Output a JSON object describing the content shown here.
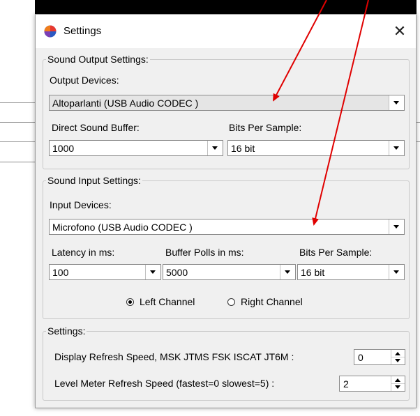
{
  "window": {
    "title": "Settings",
    "close_glyph": "✕",
    "icon": "app-logo-icon"
  },
  "output_group": {
    "legend": "Sound Output Settings:",
    "devices_label": "Output Devices:",
    "device_value": "Altoparlanti (USB Audio CODEC )",
    "buffer_label": "Direct Sound Buffer:",
    "buffer_value": "1000",
    "bits_label": "Bits Per Sample:",
    "bits_value": "16 bit"
  },
  "input_group": {
    "legend": "Sound Input Settings:",
    "devices_label": "Input Devices:",
    "device_value": "Microfono (USB Audio CODEC )",
    "latency_label": "Latency in ms:",
    "latency_value": "100",
    "polls_label": "Buffer Polls in ms:",
    "polls_value": "5000",
    "bits_label": "Bits Per Sample:",
    "bits_value": "16 bit",
    "channels": [
      {
        "label": "Left Channel",
        "selected": true
      },
      {
        "label": "Right Channel",
        "selected": false
      }
    ]
  },
  "settings_group": {
    "legend": "Settings:",
    "display_label": "Display Refresh Speed, MSK JTMS FSK ISCAT JT6M :",
    "display_value": "0",
    "meter_label": "Level Meter Refresh Speed (fastest=0 slowest=5) :",
    "meter_value": "2"
  },
  "colors": {
    "annotation_arrow": "#e00000",
    "dialog_bg": "#f0f0f0",
    "selected_field": "#e5e5e5"
  }
}
